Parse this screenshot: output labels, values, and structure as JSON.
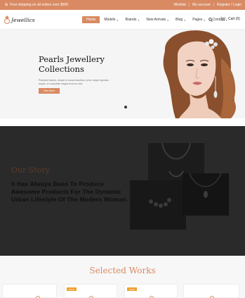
{
  "topbar": {
    "promo_text": "Free shipping on all orders over $500",
    "promo_icon": "gift-icon",
    "links": [
      "Wishlist",
      "My account",
      "Register / Login"
    ]
  },
  "header": {
    "logo_text": "Jewellics",
    "nav": [
      {
        "label": "Home",
        "active": true,
        "dropdown": false
      },
      {
        "label": "Models",
        "active": false,
        "dropdown": true
      },
      {
        "label": "Brands",
        "active": false,
        "dropdown": true
      },
      {
        "label": "New Arrivals",
        "active": false,
        "dropdown": true
      },
      {
        "label": "Blog",
        "active": false,
        "dropdown": true
      },
      {
        "label": "Pages",
        "active": false,
        "dropdown": true
      },
      {
        "label": "Contact",
        "active": false,
        "dropdown": true
      }
    ],
    "cart_label": "Cart (0)"
  },
  "hero": {
    "title": "Pearls Jewellery Collections",
    "text": "Praesent lacinia, neque id cursus faucibus, tortor neque egestas augue, eu vulputate magna eros eu erat.",
    "button": "View More"
  },
  "story": {
    "heading": "Our Story",
    "text": "It Has Always Been To Produce Awesome Products For The Dynamic Urban Lifestyle Of The Modern Woman."
  },
  "works": {
    "title": "Selected Works",
    "badge": "SALE"
  },
  "colors": {
    "accent": "#d98a62",
    "dark_section": "#2a2a2a",
    "badge": "#f0a030"
  }
}
